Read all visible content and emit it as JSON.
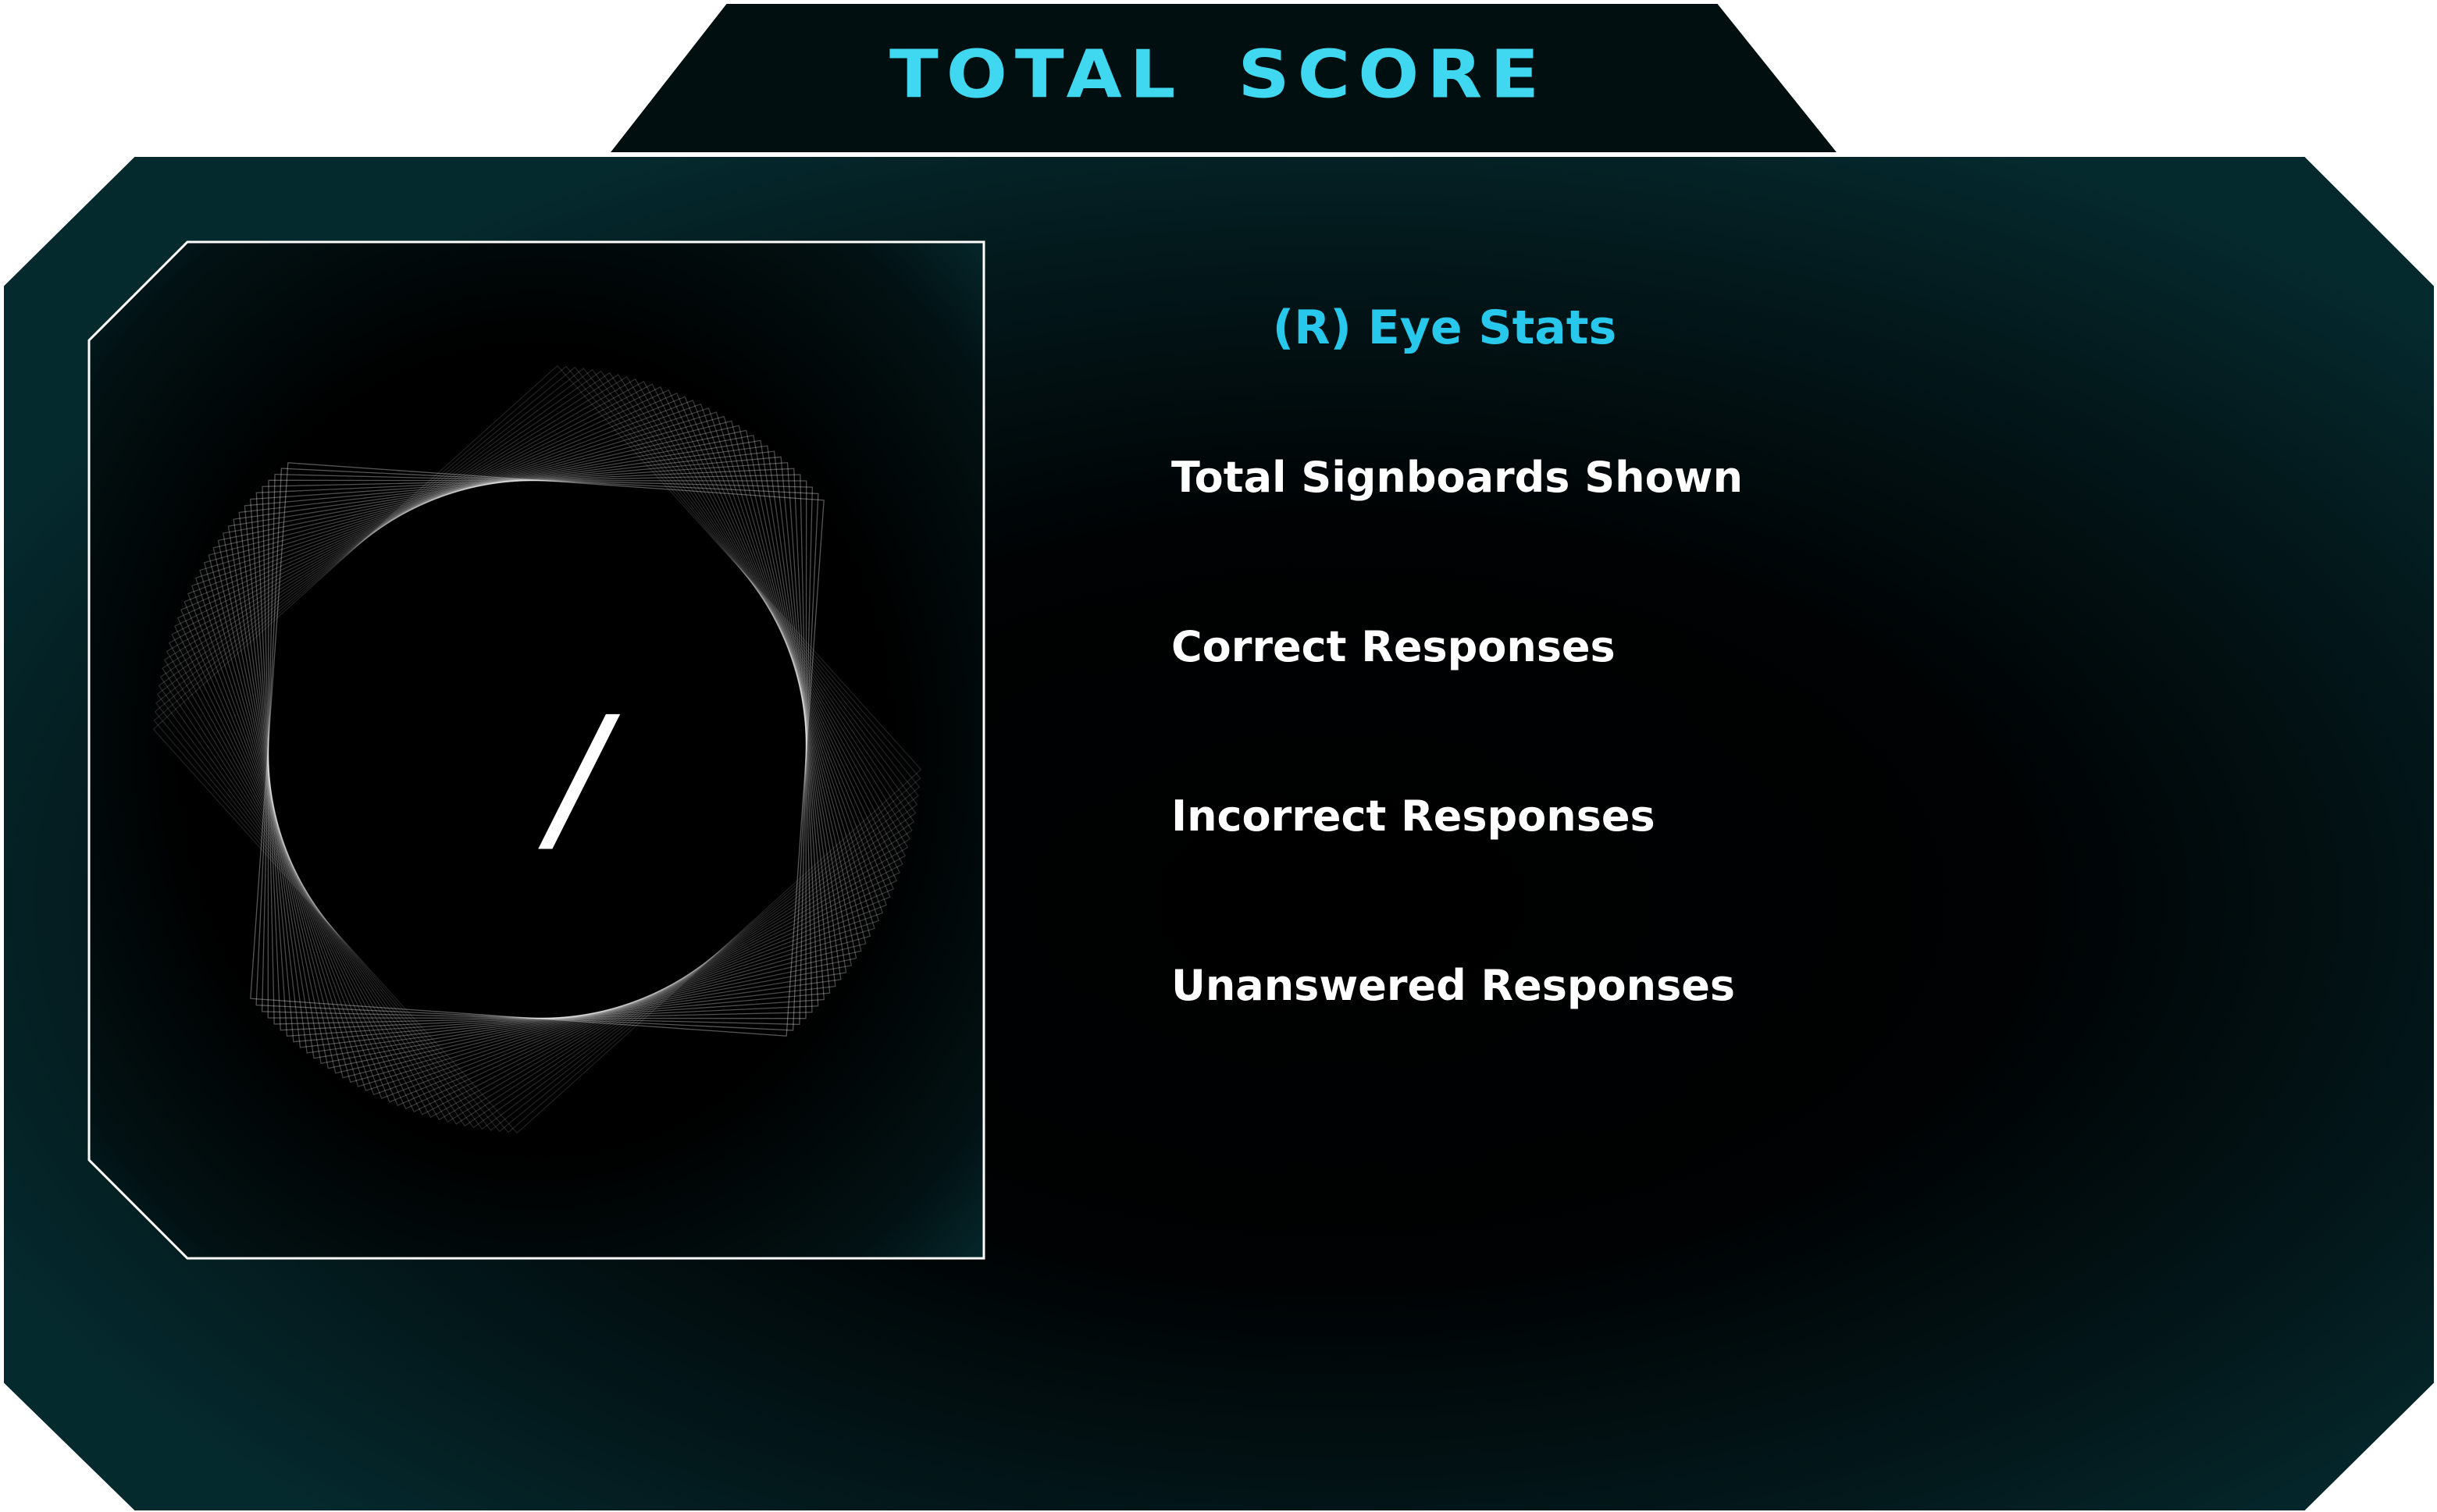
{
  "header": {
    "title": "TOTAL SCORE"
  },
  "stats_panel": {
    "heading": "(R) Eye Stats",
    "items": [
      {
        "label": "Total Signboards Shown"
      },
      {
        "label": "Correct Responses"
      },
      {
        "label": "Incorrect Responses"
      },
      {
        "label": "Unanswered Responses"
      }
    ]
  },
  "score_widget": {
    "separator": "/"
  },
  "colors": {
    "title_accent": "#3fd8f0",
    "heading_accent": "#27c8ec",
    "panel_edge": "#052a2e",
    "panel_center": "#000000",
    "text": "#ffffff"
  }
}
